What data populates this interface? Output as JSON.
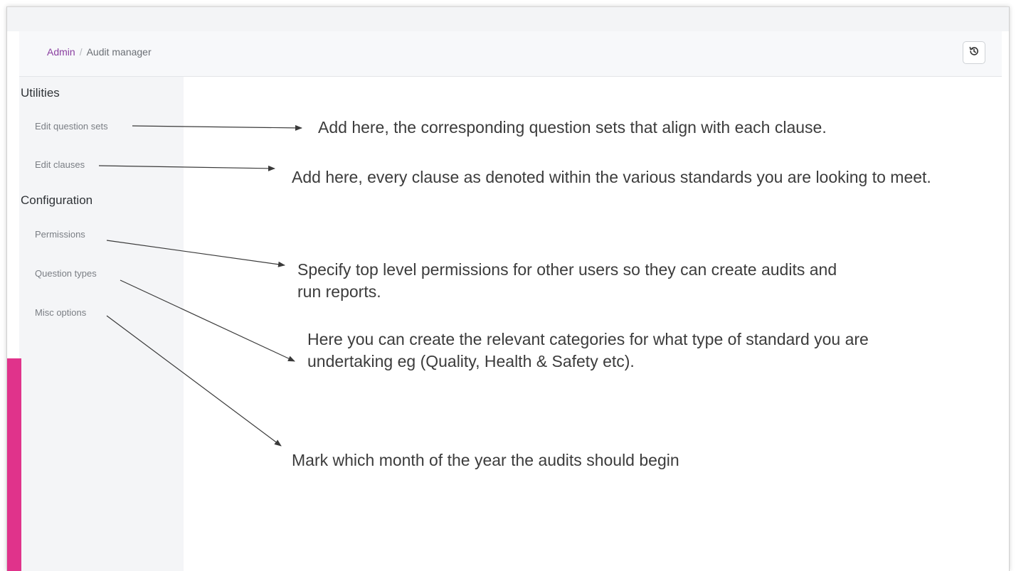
{
  "breadcrumb": {
    "root": "Admin",
    "separator": "/",
    "current": "Audit manager"
  },
  "header": {
    "history_button_icon": "history-icon"
  },
  "sidebar": {
    "sections": [
      {
        "title": "Utilities",
        "items": [
          {
            "label": "Edit question sets"
          },
          {
            "label": "Edit clauses"
          }
        ]
      },
      {
        "title": "Configuration",
        "items": [
          {
            "label": "Permissions"
          },
          {
            "label": "Question types"
          },
          {
            "label": "Misc options"
          }
        ]
      }
    ]
  },
  "annotations": [
    {
      "text": "Add here, the corresponding question sets that align with each clause."
    },
    {
      "text": "Add here, every clause as denoted within the various standards you are looking to meet."
    },
    {
      "text": "Specify top level permissions for other users so they can create audits and run reports."
    },
    {
      "text": "Here you can create the relevant categories for what type of standard you are undertaking eg (Quality, Health & Safety etc)."
    },
    {
      "text": "Mark which month of the year the audits should begin"
    }
  ],
  "colors": {
    "accent": "#e0338b",
    "link": "#8a3fa0",
    "arrow": "#3a3a3a"
  }
}
